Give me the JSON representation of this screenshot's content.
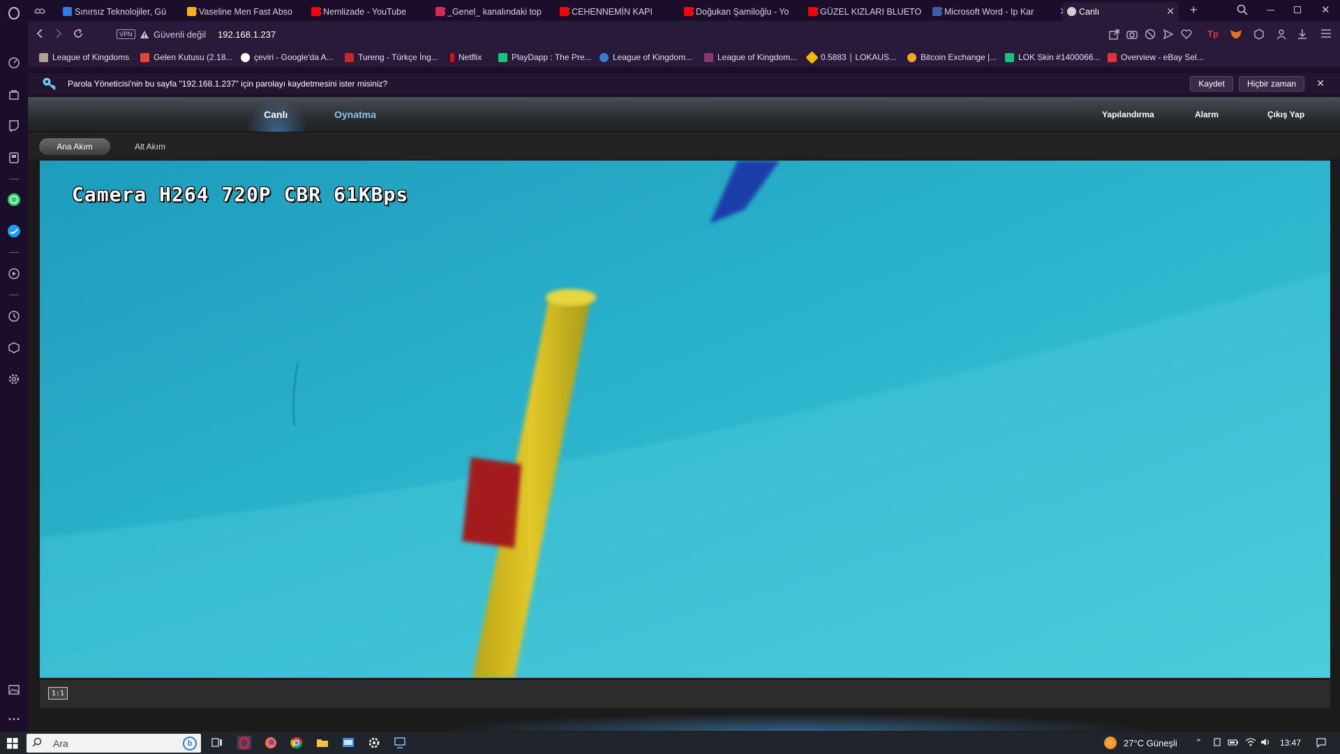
{
  "browser": {
    "tabs": [
      {
        "title": "Sınırsız Teknolojiler, Gü",
        "favicon_color": "#2b7de9"
      },
      {
        "title": "Vaseline Men Fast Abso",
        "favicon_color": "#f6b40e"
      },
      {
        "title": "Nemlizade - YouTube",
        "favicon_color": "#ff0000"
      },
      {
        "title": "_Genel_ kanalındaki top",
        "favicon_color": "#e0245e"
      },
      {
        "title": "CEHENNEMİN KAPI",
        "favicon_color": "#ff0000"
      },
      {
        "title": "Doğukan Şamiloğlu - Yo",
        "favicon_color": "#ff0000"
      },
      {
        "title": "GÜZEL KIZLARI BLUETO",
        "favicon_color": "#ff0000"
      },
      {
        "title": "Microsoft Word - Ip Kar",
        "favicon_color": "#3b5fa8"
      },
      {
        "title": "Canlı",
        "favicon_color": "#cfcfcf"
      }
    ],
    "address": {
      "vpn_label": "VPN",
      "security_text": "Güvenli değil",
      "url": "192.168.1.237"
    },
    "bookmarks": [
      {
        "label": "League of Kingdoms",
        "color": "#b0a090"
      },
      {
        "label": "Gelen Kutusu (2.18...",
        "color": "#ea4335"
      },
      {
        "label": "çeviri - Google'da A...",
        "color": "#ffffff"
      },
      {
        "label": "Tureng - Türkçe İng...",
        "color": "#c62828"
      },
      {
        "label": "Netflix",
        "color": "#e50914"
      },
      {
        "label": "PlayDapp : The Pre...",
        "color": "#19c37d"
      },
      {
        "label": "League of Kingdom...",
        "color": "#3a7bd5"
      },
      {
        "label": "League of Kingdom...",
        "color": "#8a3a6a"
      },
      {
        "label": "0.5883 ∣ LOKAUS...",
        "color": "#f0b90b"
      },
      {
        "label": "Bitcoin Exchange |...",
        "color": "#f5a623"
      },
      {
        "label": "LOK Skin #1400066...",
        "color": "#19c37d"
      },
      {
        "label": "Overview - eBay Sel...",
        "color": "#e53238"
      }
    ],
    "password_prompt": {
      "message": "Parola Yöneticisi'nin bu sayfa \"192.168.1.237\" için parolayı kaydetmesini ister misiniz?",
      "save_label": "Kaydet",
      "never_label": "Hiçbir zaman"
    }
  },
  "camera_ui": {
    "nav": {
      "live": "Canlı",
      "playback": "Oynatma",
      "config": "Yapılandırma",
      "alarm": "Alarm",
      "logout": "Çıkış Yap"
    },
    "streams": {
      "main": "Ana Akım",
      "sub": "Alt Akım"
    },
    "osd_text": "Camera H264 720P CBR 61KBps",
    "ratio_button": "1:1"
  },
  "taskbar": {
    "search_placeholder": "Ara",
    "weather": "27°C  Güneşli",
    "time": "13:47"
  }
}
